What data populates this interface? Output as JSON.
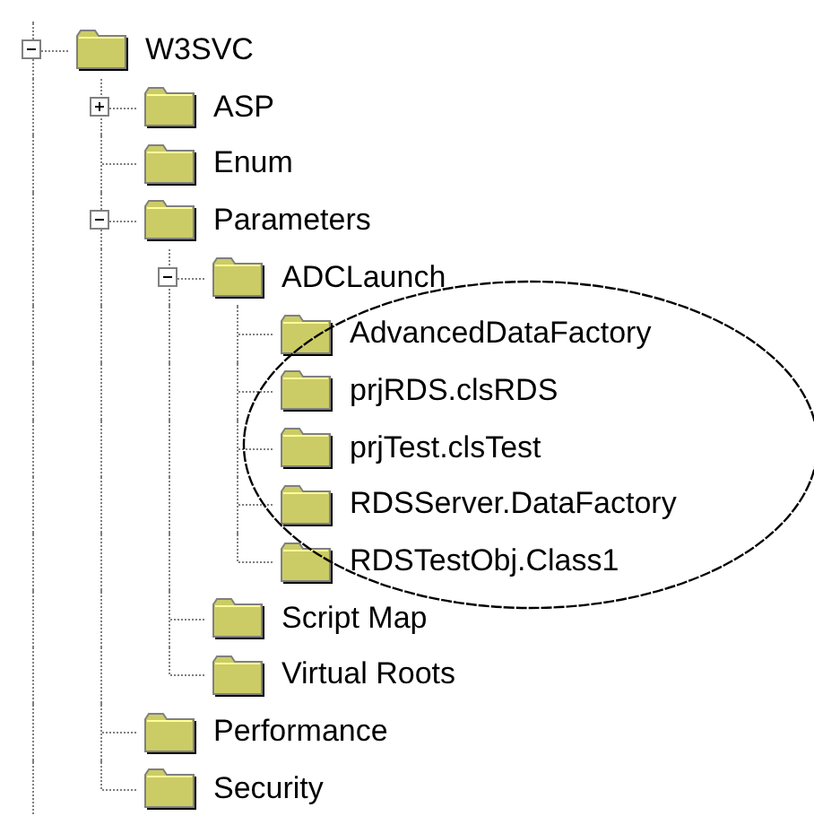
{
  "tree": [
    {
      "label": "W3SVC",
      "expanded": true,
      "children": [
        {
          "label": "ASP",
          "expanded": false
        },
        {
          "label": "Enum"
        },
        {
          "label": "Parameters",
          "expanded": true,
          "children": [
            {
              "label": "ADCLaunch",
              "expanded": true,
              "children": [
                {
                  "label": "AdvancedDataFactory"
                },
                {
                  "label": "prjRDS.clsRDS"
                },
                {
                  "label": "prjTest.clsTest"
                },
                {
                  "label": "RDSServer.DataFactory"
                },
                {
                  "label": "RDSTestObj.Class1"
                }
              ]
            },
            {
              "label": "Script Map"
            },
            {
              "label": "Virtual Roots"
            }
          ]
        },
        {
          "label": "Performance"
        },
        {
          "label": "Security"
        }
      ]
    }
  ]
}
